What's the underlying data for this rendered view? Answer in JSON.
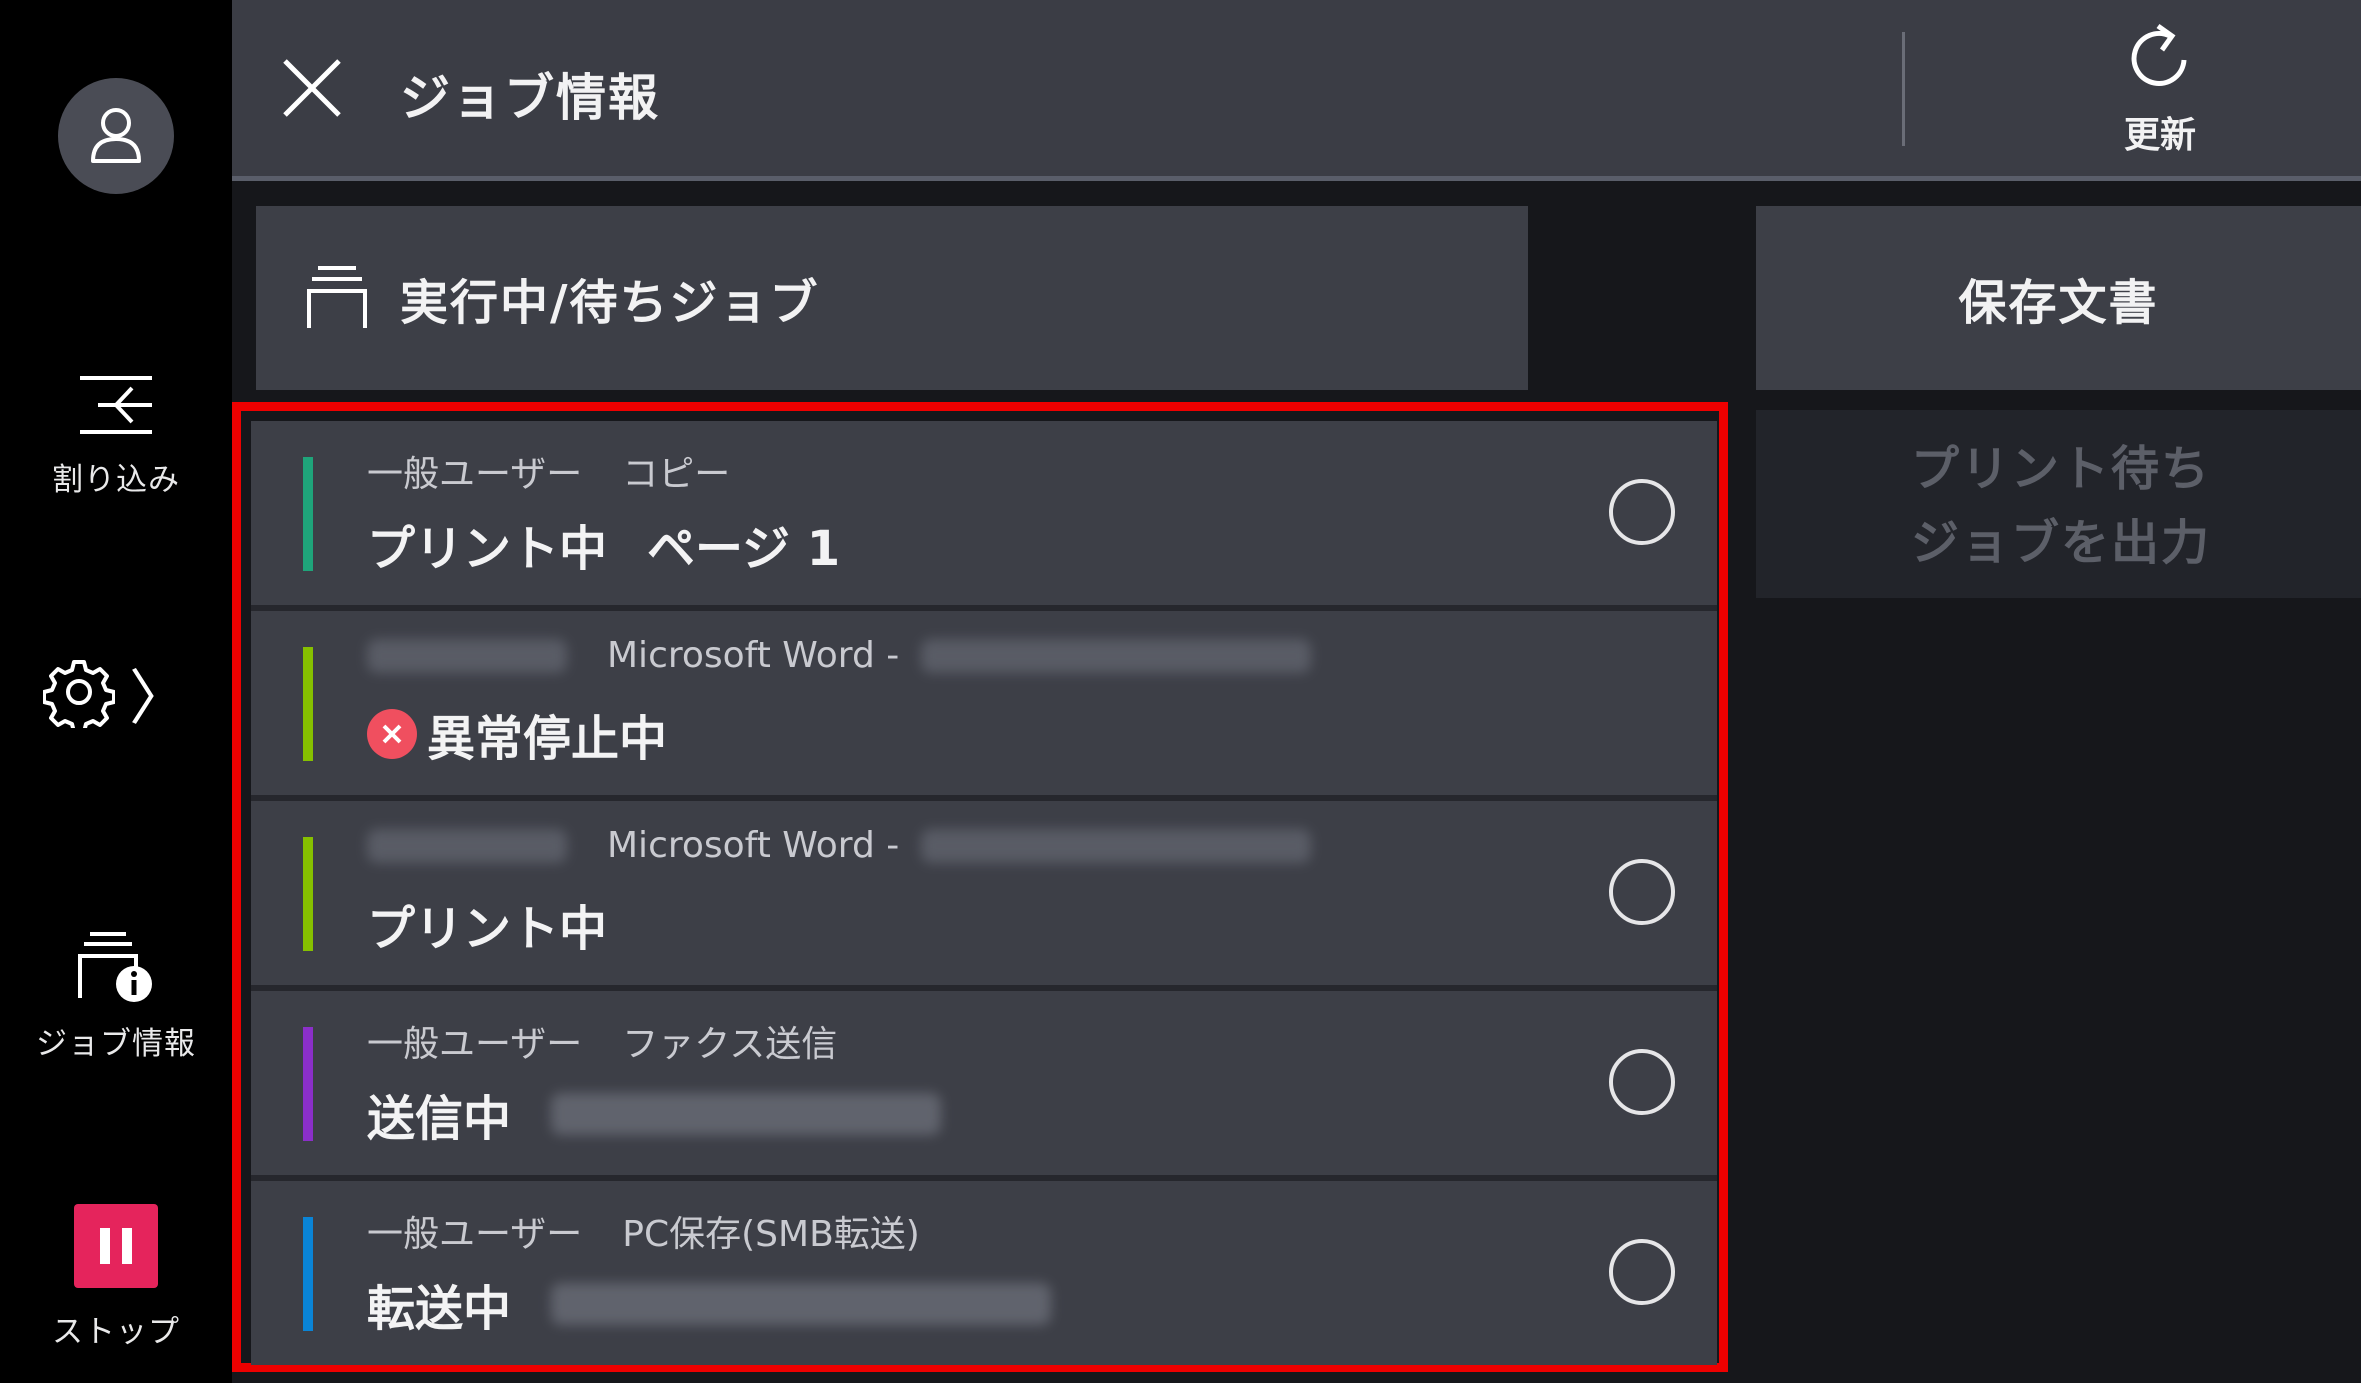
{
  "rail": {
    "interrupt_label": "割り込み",
    "job_info_label": "ジョブ情報",
    "stop_label": "ストップ",
    "settings_chevron": "〉"
  },
  "header": {
    "title": "ジョブ情報",
    "refresh_label": "更新"
  },
  "tabs": {
    "active_label": "実行中/待ちジョブ",
    "saved_label": "保存文書"
  },
  "side_panel": {
    "line1": "プリント待ち",
    "line2": "ジョブを出力"
  },
  "jobs": [
    {
      "user": "一般ユーザー",
      "type": "コピー",
      "status": "プリント中",
      "detail": "ページ 1",
      "bar_color": "#1fa47a",
      "has_error": false
    },
    {
      "user": "",
      "type": "Microsoft Word -",
      "status": "異常停止中",
      "detail": "",
      "bar_color": "#86c000",
      "has_error": true
    },
    {
      "user": "",
      "type": "Microsoft Word -",
      "status": "プリント中",
      "detail": "",
      "bar_color": "#86c000",
      "has_error": false
    },
    {
      "user": "一般ユーザー",
      "type": "ファクス送信",
      "status": "送信中",
      "detail": "",
      "bar_color": "#8b2fc9",
      "has_error": false
    },
    {
      "user": "一般ユーザー",
      "type": "PC保存(SMB転送)",
      "status": "転送中",
      "detail": "",
      "bar_color": "#0a84d6",
      "has_error": false
    }
  ],
  "colors": {
    "frame": "#ee0000",
    "stop": "#e5245c",
    "error": "#f04f5f"
  }
}
